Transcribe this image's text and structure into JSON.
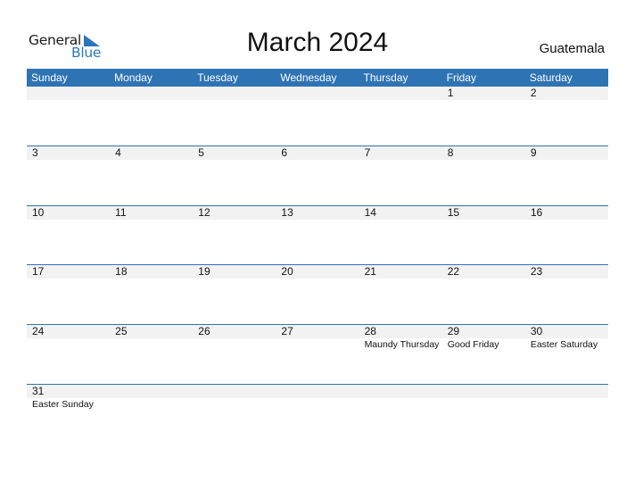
{
  "logo": {
    "line1": "General",
    "line2": "Blue"
  },
  "title": "March 2024",
  "country": "Guatemala",
  "colors": {
    "accent": "#2e73b4",
    "strip": "#f2f2f2"
  },
  "weekdays": [
    "Sunday",
    "Monday",
    "Tuesday",
    "Wednesday",
    "Thursday",
    "Friday",
    "Saturday"
  ],
  "weeks": [
    [
      {
        "day": ""
      },
      {
        "day": ""
      },
      {
        "day": ""
      },
      {
        "day": ""
      },
      {
        "day": ""
      },
      {
        "day": "1"
      },
      {
        "day": "2"
      }
    ],
    [
      {
        "day": "3"
      },
      {
        "day": "4"
      },
      {
        "day": "5"
      },
      {
        "day": "6"
      },
      {
        "day": "7"
      },
      {
        "day": "8"
      },
      {
        "day": "9"
      }
    ],
    [
      {
        "day": "10"
      },
      {
        "day": "11"
      },
      {
        "day": "12"
      },
      {
        "day": "13"
      },
      {
        "day": "14"
      },
      {
        "day": "15"
      },
      {
        "day": "16"
      }
    ],
    [
      {
        "day": "17"
      },
      {
        "day": "18"
      },
      {
        "day": "19"
      },
      {
        "day": "20"
      },
      {
        "day": "21"
      },
      {
        "day": "22"
      },
      {
        "day": "23"
      }
    ],
    [
      {
        "day": "24"
      },
      {
        "day": "25"
      },
      {
        "day": "26"
      },
      {
        "day": "27"
      },
      {
        "day": "28",
        "event": "Maundy Thursday"
      },
      {
        "day": "29",
        "event": "Good Friday"
      },
      {
        "day": "30",
        "event": "Easter Saturday"
      }
    ],
    [
      {
        "day": "31",
        "event": "Easter Sunday"
      },
      {
        "day": ""
      },
      {
        "day": ""
      },
      {
        "day": ""
      },
      {
        "day": ""
      },
      {
        "day": ""
      },
      {
        "day": ""
      }
    ]
  ]
}
